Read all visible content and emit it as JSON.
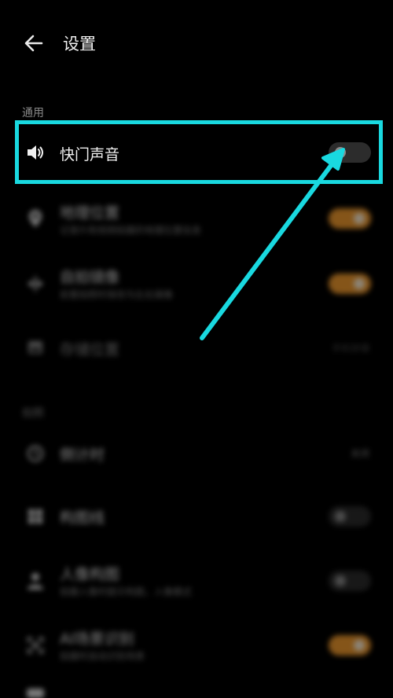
{
  "header": {
    "title": "设置"
  },
  "sections": {
    "general_label": "通用",
    "shooting_label": "拍照"
  },
  "rows": {
    "shutter_sound": {
      "title": "快门声音",
      "enabled": false
    },
    "location": {
      "title": "地理位置",
      "subtitle": "记录片和视频拍摄的地理位置信息",
      "enabled": true
    },
    "selfie_mirror": {
      "title": "自拍镜像",
      "subtitle": "前置拍照时保存为左右镜像",
      "enabled": true
    },
    "storage": {
      "title": "存储位置",
      "value": "手机存储"
    },
    "timer": {
      "title": "倒计时",
      "value": "关闭"
    },
    "grid": {
      "title": "构图线",
      "enabled": false
    },
    "portrait_composition": {
      "title": "人像构图",
      "subtitle": "拍摄人像时提示构图，人像模式",
      "enabled": false
    },
    "ai_scene": {
      "title": "AI场景识别",
      "subtitle": "拍摄时自动识别场景",
      "enabled": true
    }
  },
  "colors": {
    "highlight": "#19d9e0",
    "toggle_on": "#f29b2e",
    "toggle_off": "#2c2c2c"
  }
}
